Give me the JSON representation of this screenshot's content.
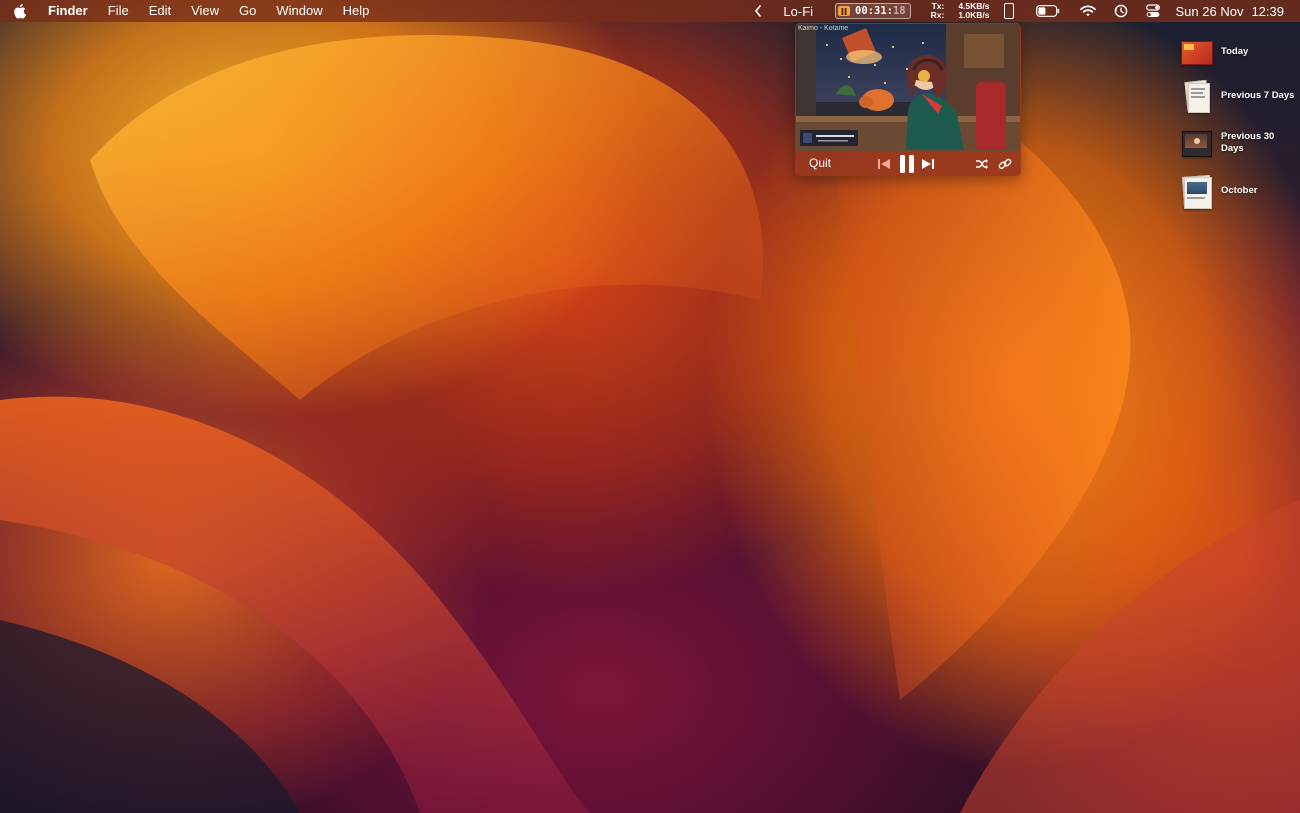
{
  "menubar": {
    "apple_icon": "apple-logo-icon",
    "app_name": "Finder",
    "menus": [
      "File",
      "Edit",
      "View",
      "Go",
      "Window",
      "Help"
    ],
    "status": {
      "music_app_label": "Lo-Fi",
      "timer": {
        "main": "00:31:",
        "seconds": "18"
      },
      "network": {
        "tx_label": "Tx:",
        "rx_label": "Rx:",
        "tx_value": "4.5KB/s",
        "rx_value": "1.0KB/s"
      },
      "icons": [
        "chevron-left-icon",
        "phone-icon",
        "battery-icon",
        "wifi-icon",
        "time-machine-icon",
        "control-center-icon"
      ],
      "date": "Sun 26 Nov",
      "time": "12:39"
    }
  },
  "player": {
    "video_title": "Kaimo - Kotame",
    "quit_label": "Quit",
    "controls": [
      "previous-track-icon",
      "pause-icon",
      "next-track-icon",
      "shuffle-icon",
      "link-icon"
    ],
    "accent": "#f2a33a"
  },
  "desktop": {
    "stacks": [
      {
        "label": "Today"
      },
      {
        "label": "Previous 7 Days"
      },
      {
        "label": "Previous 30 Days"
      },
      {
        "label": "October"
      }
    ]
  }
}
